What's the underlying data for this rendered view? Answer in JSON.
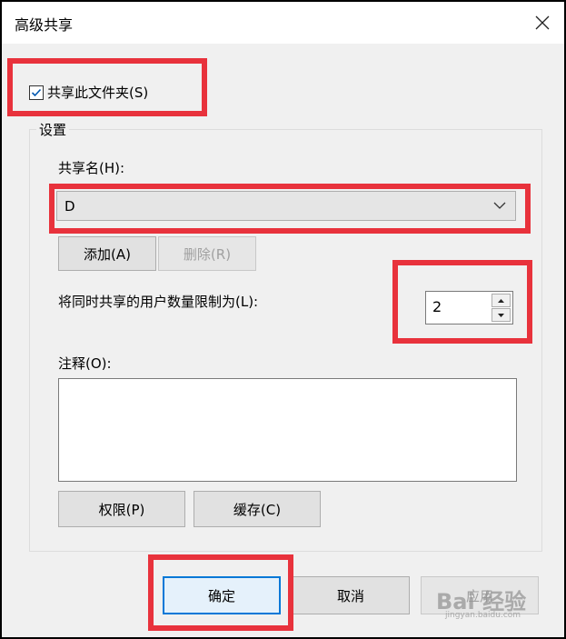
{
  "window": {
    "title": "高级共享",
    "close_icon": "close-icon"
  },
  "share_checkbox": {
    "label": "共享此文件夹(S)",
    "checked": true
  },
  "settings": {
    "legend": "设置",
    "share_name_label": "共享名(H):",
    "share_name_value": "D",
    "add_label": "添加(A)",
    "remove_label": "删除(R)",
    "limit_label": "将同时共享的用户数量限制为(L):",
    "limit_value": "2",
    "comment_label": "注释(O):",
    "comment_value": "",
    "permissions_label": "权限(P)",
    "caching_label": "缓存(C)"
  },
  "footer": {
    "ok_label": "确定",
    "cancel_label": "取消",
    "apply_label": "应用"
  },
  "watermark": {
    "text": "Bai 经验",
    "sub": "jingyan.baidu.com"
  },
  "colors": {
    "highlight": "#e8323c",
    "accent": "#0078d7"
  }
}
